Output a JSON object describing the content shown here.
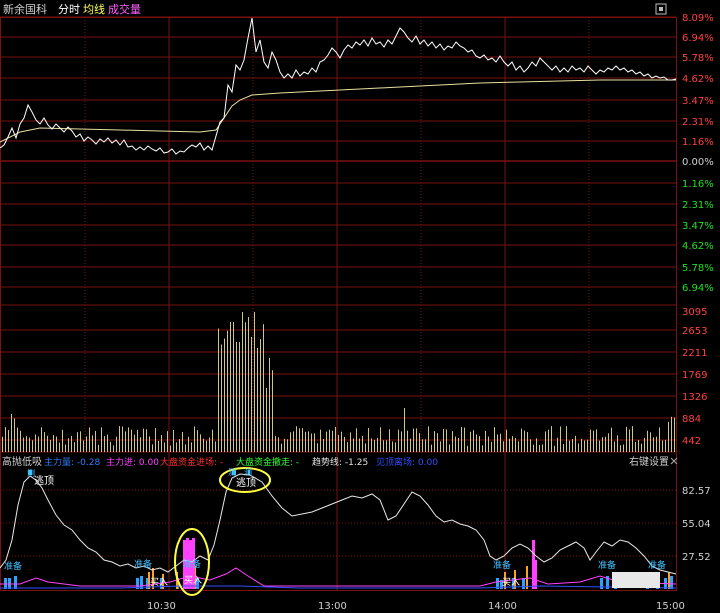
{
  "header": {
    "stock_name": "新余国科",
    "tab_intraday": "分时",
    "tab_avg": "均线",
    "tab_volume": "成交量",
    "icon": "settings-icon"
  },
  "price_axis": {
    "up_labels": [
      "8.09%",
      "6.94%",
      "5.78%",
      "4.62%",
      "3.47%",
      "2.31%",
      "1.16%",
      "0.00%"
    ],
    "down_labels": [
      "1.16%",
      "2.31%",
      "3.47%",
      "4.62%",
      "5.78%",
      "6.94%"
    ]
  },
  "volume_axis": {
    "labels": [
      "3095",
      "2653",
      "2211",
      "1769",
      "1326",
      "884",
      "442"
    ]
  },
  "indicator": {
    "title": "高抛低吸",
    "items": [
      {
        "label": "主力量: -0.28",
        "color": "#2f7dff"
      },
      {
        "label": "主力进: 0.00",
        "color": "#ff40ff"
      },
      {
        "label": "大盘资金进场: -",
        "color": "#ff3030"
      },
      {
        "label": "大盘资金撤走: -",
        "color": "#30ff30"
      },
      {
        "label": "趋势线: -1.25",
        "color": "#e0e0e0"
      },
      {
        "label": "见顶离场: 0.00",
        "color": "#3050ff"
      }
    ],
    "right_settings": "右键设置",
    "close_icon": "close-icon",
    "axis_labels": [
      "82.57",
      "55.04",
      "27.52"
    ]
  },
  "annotations": {
    "top1": "逃顶",
    "top2": "逃顶",
    "top_mark_a": "测",
    "top_mark_b": "测",
    "prepare": "准备",
    "buy": "买入",
    "buy2": "买入"
  },
  "time_axis": {
    "labels": [
      "10:30",
      "13:00",
      "14:00",
      "15:00"
    ]
  },
  "colors": {
    "grid": "#7a1010",
    "price_line": "#ffffff",
    "avg_line": "#e8e0a0",
    "axis_text_up": "#ff4040",
    "axis_text_down": "#20e020",
    "volume_bar": "#d0c880"
  }
}
